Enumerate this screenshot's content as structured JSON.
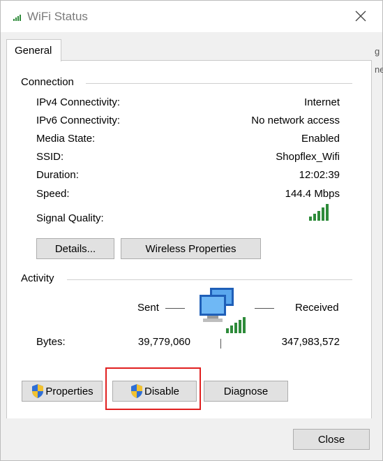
{
  "window": {
    "title": "WiFi Status",
    "active_tab": "General"
  },
  "background_bleed": [
    "g",
    "ne"
  ],
  "connection": {
    "group_label": "Connection",
    "rows": [
      {
        "label": "IPv4 Connectivity:",
        "value": "Internet"
      },
      {
        "label": "IPv6 Connectivity:",
        "value": "No network access"
      },
      {
        "label": "Media State:",
        "value": "Enabled"
      },
      {
        "label": "SSID:",
        "value": "Shopflex_Wifi"
      },
      {
        "label": "Duration:",
        "value": "12:02:39"
      },
      {
        "label": "Speed:",
        "value": "144.4 Mbps"
      }
    ],
    "signal_quality_label": "Signal Quality:",
    "signal_bars": 5,
    "details_button": "Details...",
    "wireless_properties_button": "Wireless Properties"
  },
  "activity": {
    "group_label": "Activity",
    "sent_label": "Sent",
    "received_label": "Received",
    "bytes_label": "Bytes:",
    "bytes_sent": "39,779,060",
    "bytes_received": "347,983,572"
  },
  "buttons": {
    "properties": "Properties",
    "disable": "Disable",
    "diagnose": "Diagnose",
    "close": "Close"
  },
  "colors": {
    "signal_green": "#2e8b3a",
    "highlight_red": "#e02020",
    "shield_blue": "#2f6fd6",
    "shield_yellow": "#f2c230"
  }
}
